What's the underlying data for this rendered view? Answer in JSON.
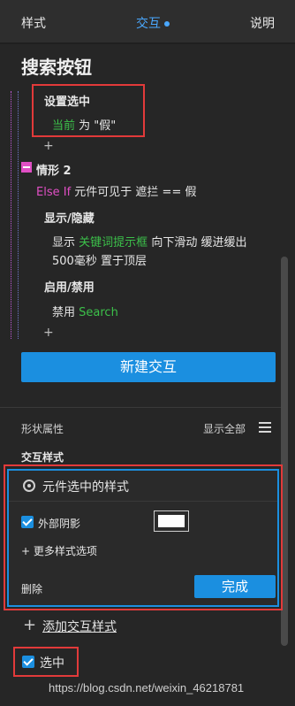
{
  "tabs": {
    "style": "样式",
    "interaction": "交互",
    "notes": "说明"
  },
  "panel_title": "搜索按钮",
  "case1": {
    "action_title": "设置选中",
    "current": "当前",
    "value_text": "为 \"假\""
  },
  "case2": {
    "label": "情形 2",
    "condition_keyword": "Else If",
    "condition_text": "元件可见于 遮拦 == 假",
    "show_hide_title": "显示/隐藏",
    "show_prefix": "显示",
    "show_target": "关键词提示框",
    "show_rest": "向下滑动 缓进缓出",
    "show_line2": "500毫秒 置于顶层",
    "enable_title": "启用/禁用",
    "disable_prefix": "禁用",
    "disable_target": "Search"
  },
  "plus_sign": "+",
  "new_interaction_button": "新建交互",
  "shape_props": {
    "label": "形状属性",
    "show_all": "显示全部"
  },
  "interaction_styles": {
    "title": "交互样式",
    "selected_style": "元件选中的样式",
    "outer_shadow": "外部阴影",
    "more_options": "+ 更多样式选项",
    "delete": "删除",
    "done": "完成",
    "add_style": "添加交互样式"
  },
  "selected_checkbox_label": "选中",
  "watermark": "https://blog.csdn.net/weixin_46218781",
  "colors": {
    "accent": "#1b8fe0",
    "highlight": "#e23a3a",
    "green": "#3cc04a",
    "case": "#e04fc4"
  }
}
